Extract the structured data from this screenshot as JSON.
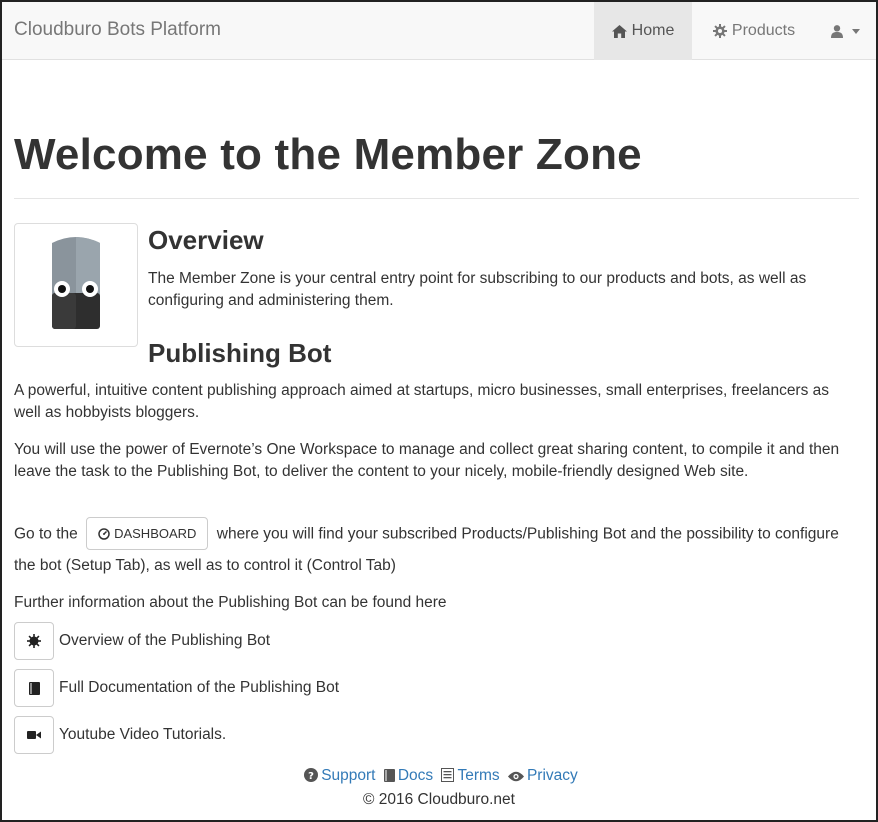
{
  "navbar": {
    "brand": "Cloudburo Bots Platform",
    "home_label": "Home",
    "products_label": "Products",
    "home_icon": "home-icon",
    "products_icon": "gear-icon",
    "user_icon": "user-icon"
  },
  "page": {
    "title": "Welcome to the Member Zone"
  },
  "overview": {
    "heading": "Overview",
    "text": "The Member Zone is your central entry point for subscribing to our products and bots, as well as configuring and administering them."
  },
  "publishing_bot": {
    "heading": "Publishing Bot",
    "para1": "A powerful, intuitive content publishing approach aimed at startups, micro businesses, small enterprises, freelancers as well as hobbyists bloggers.",
    "para2": "You will use the power of Evernote’s One Workspace to manage and collect great sharing content, to compile it and then leave the task to the Publishing Bot, to deliver the content to your nicely, mobile-friendly designed Web site.",
    "goto_prefix": "Go to the",
    "dashboard_label": "DASHBOARD",
    "goto_suffix": "where you will find your subscribed Products/Publishing Bot and the possibility to configure the bot (Setup Tab), as well as to control it (Control Tab)",
    "further_info": "Further information about the Publishing Bot can be found here"
  },
  "links": [
    {
      "icon": "certificate-icon",
      "label": "Overview of the Publishing Bot"
    },
    {
      "icon": "book-icon",
      "label": "Full Documentation of the Publishing Bot"
    },
    {
      "icon": "video-camera-icon",
      "label": "Youtube Video Tutorials."
    }
  ],
  "footer": {
    "support": "Support",
    "docs": "Docs",
    "terms": "Terms",
    "privacy": "Privacy",
    "copyright": "© 2016 Cloudburo.net"
  },
  "colors": {
    "link": "#337ab7",
    "navbar_bg": "#f8f8f8",
    "active_nav_bg": "#e7e7e7",
    "text": "#333333"
  }
}
